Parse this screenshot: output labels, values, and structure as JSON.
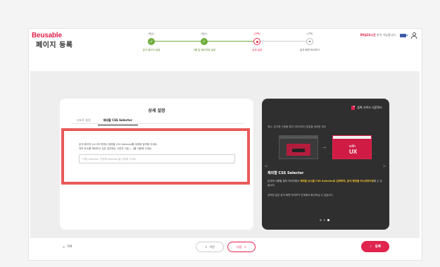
{
  "app": {
    "logo": "Beusable",
    "trial_text": "99일24시간",
    "trial_suffix": " 분석 가능합니다",
    "icons": [
      "battery-icon",
      "user-icon"
    ]
  },
  "page": {
    "title": "페이지 등록"
  },
  "steps": [
    {
      "num": "(필수)",
      "label": "분석 페이지 설정",
      "state": "done"
    },
    {
      "num": "(필수)",
      "label": "그룹 및 페이지명 설정",
      "state": "done"
    },
    {
      "num": "(선택)",
      "label": "상세 설정",
      "state": "active"
    },
    {
      "num": "(선택)",
      "label": "분석 화면 미리보기",
      "state": "todo"
    }
  ],
  "settings": {
    "title": "상세 설정",
    "tabs": [
      {
        "label": "리포트 설정",
        "active": false
      },
      {
        "label": "제외할 CSS Selector",
        "active": true
      }
    ],
    "description_line1": "분석 페이지 소스코드안에서 제외할 CSS Selector를 아래에 입력해 주세요.",
    "description_line2": "여러 요소를 제외하고 싶은 경우에는 구분자 기호 ( , )를 사용해 주세요.",
    "input_placeholder": "다중(.selector, 다양해.selector)을 입력해 주세요",
    "input_value": ""
  },
  "guide": {
    "download_label": "등록 가이드 다운로드",
    "example_caption": "예시: 분석에 사용할 캡쳐 이미지에서 팝업을 제외한 경우",
    "ux_main": "UX",
    "ux_sub": "with",
    "title": "제외할 CSS Selector",
    "desc_pre": "분석에 사용될 캡처 이미지에서 ",
    "desc_highlight": "제외할 요소를 CSS Selector로 입력하여, 분석 화면을 커스터마이징",
    "desc_post": "할 수 있습니다.",
    "desc2": "입력한 값은 분석 화면 미리보기 단계에서 확인하실 수 있습니다.",
    "prev_arrow": "<",
    "next_arrow": ">",
    "slides": [
      false,
      false,
      true
    ]
  },
  "footer": {
    "list_label": "목록",
    "list_icon": "<",
    "prev_label": "이전",
    "prev_icon": "<",
    "next_label": "다음",
    "next_icon": ">",
    "register_label": "등록",
    "register_icon": "✓"
  },
  "colors": {
    "brand": "#e0244d",
    "done": "#6fae3c",
    "highlight_border": "#e85a5a",
    "dark_panel": "#2f2f2f"
  }
}
